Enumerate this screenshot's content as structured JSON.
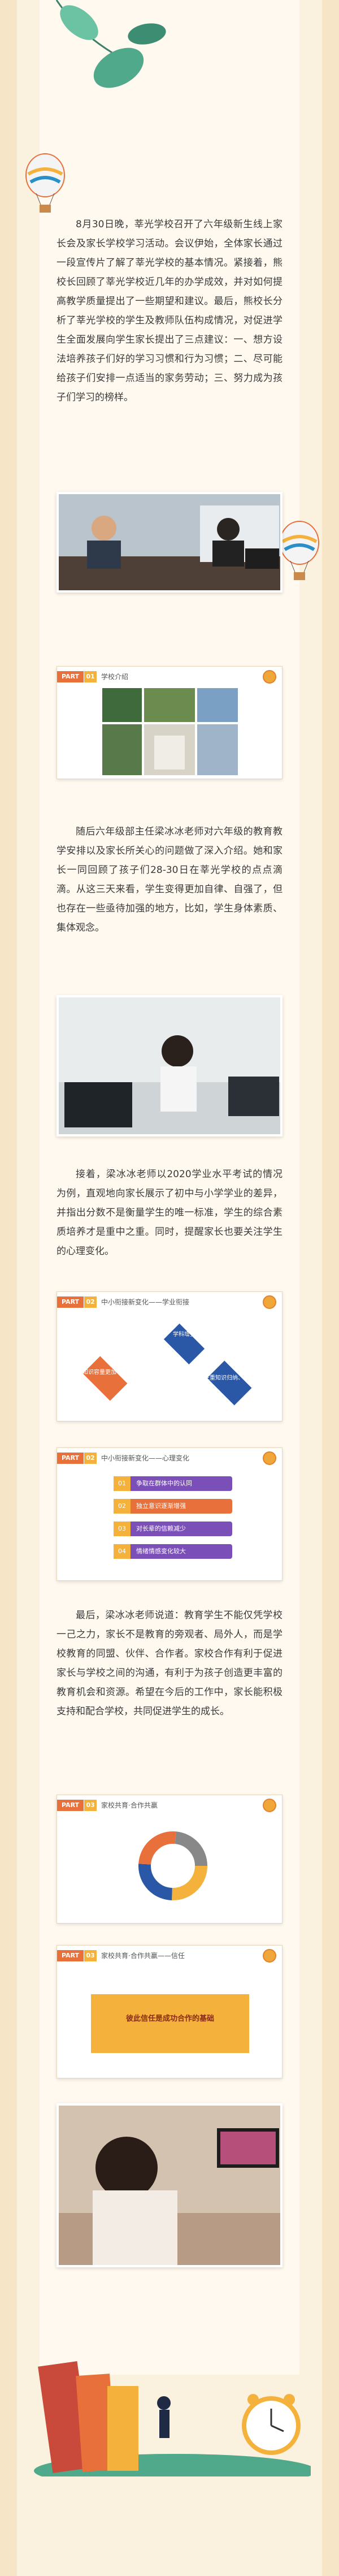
{
  "paragraphs": [
    "8月30日晚，莘光学校召开了六年级新生线上家长会及家长学校学习活动。会议伊始，全体家长通过一段宣传片了解了莘光学校的基本情况。紧接着，熊校长回顾了莘光学校近几年的办学成效，并对如何提高教学质量提出了一些期望和建议。最后，熊校长分析了莘光学校的学生及教师队伍构成情况，对促进学生全面发展向学生家长提出了三点建议：一、想方设法培养孩子们好的学习习惯和行为习惯；二、尽可能给孩子们安排一点适当的家务劳动；三、努力成为孩子们学习的榜样。",
    "随后六年级部主任梁冰冰老师对六年级的教育教学安排以及家长所关心的问题做了深入介绍。她和家长一同回顾了孩子们28-30日在莘光学校的点点滴滴。从这三天来看，学生变得更加自律、自强了，但也存在一些亟待加强的地方，比如，学生身体素质、集体观念。",
    "接着，梁冰冰老师以2020学业水平考试的情况为例，直观地向家长展示了初中与小学学业的差异，并指出分数不是衡量学生的唯一标准，学生的综合素质培养才是重中之重。同时，提醒家长也要关注学生的心理变化。",
    "最后，梁冰冰老师说道：教育学生不能仅凭学校一己之力，家长不是教育的旁观者、局外人，而是学校教育的同盟、伙伴、合作者。家校合作有利于促进家长与学校之间的沟通，有利于为孩子创造更丰富的教育机会和资源。希望在今后的工作中，家长能积极支持和配合学校，共同促进学生的成长。"
  ],
  "slides": {
    "s1": {
      "part": "PART",
      "num": "01",
      "title": "学校介绍"
    },
    "s2": {
      "part": "PART",
      "num": "02",
      "title": "中小衔接新变化——学业衔接",
      "boxes": [
        "学科增多",
        "知识容量更加丰富",
        "注重知识归纳、综合"
      ]
    },
    "s3": {
      "part": "PART",
      "num": "02",
      "title": "中小衔接新变化——心理变化",
      "items": [
        "争取在群体中的认同",
        "独立意识逐渐增强",
        "对长辈的信赖减少",
        "情绪情感变化较大"
      ],
      "nums": [
        "01",
        "02",
        "03",
        "04"
      ]
    },
    "s4": {
      "part": "PART",
      "num": "03",
      "title": "家校共育·合作共赢"
    },
    "s5": {
      "part": "PART",
      "num": "03",
      "title": "家校共育·合作共赢——信任",
      "banner": "彼此信任是成功合作的基础"
    }
  },
  "colors": {
    "accent": "#e8703a",
    "gold": "#f4b23d",
    "blue": "#2a57a6",
    "purple": "#7b4fb8",
    "leaf": "#4fa98a"
  }
}
